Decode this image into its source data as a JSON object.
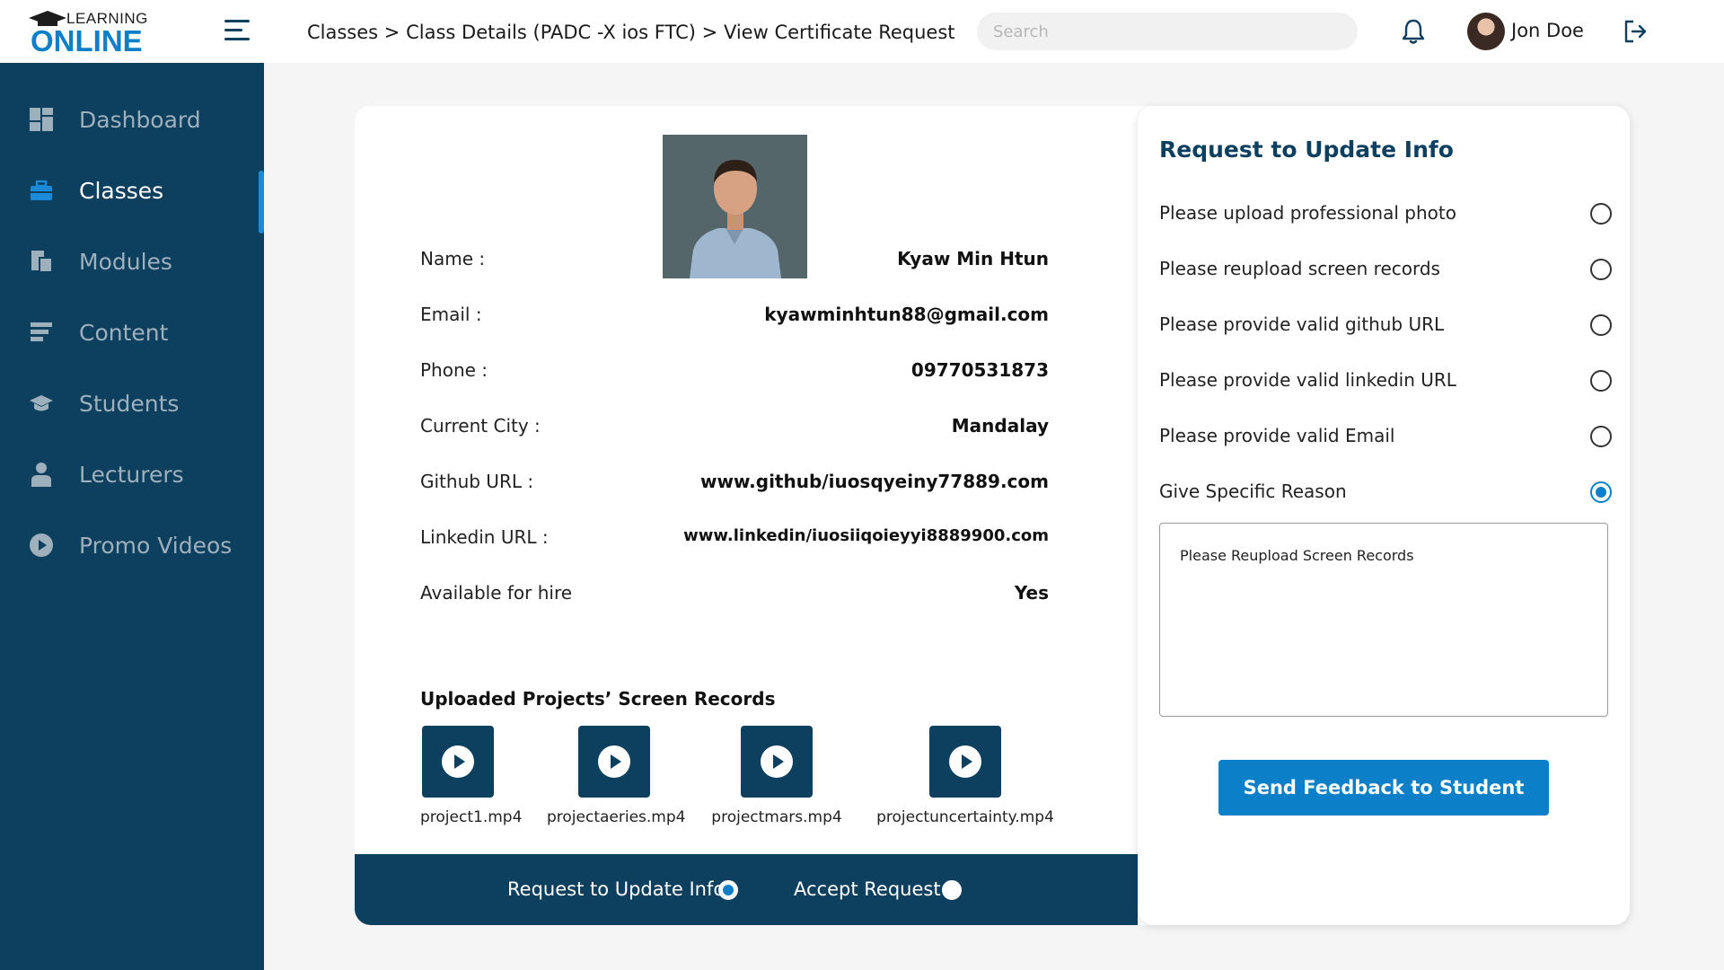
{
  "app": {
    "logo_small": "LEARNING",
    "logo_big": "ONLINE"
  },
  "header": {
    "breadcrumb": [
      {
        "label": "Classes"
      },
      {
        "label": "Class Details (PADC -X ios FTC)"
      },
      {
        "label": "View Certificate Request"
      }
    ],
    "breadcrumb_sep": ">",
    "search_placeholder": "Search",
    "user_name": "Jon Doe",
    "icons": {
      "menu": "hamburger-menu-icon",
      "bell": "bell-icon",
      "logout": "logout-icon"
    }
  },
  "sidebar": {
    "items": [
      {
        "label": "Dashboard",
        "icon": "dashboard-icon",
        "active": false
      },
      {
        "label": "Classes",
        "icon": "briefcase-icon",
        "active": true
      },
      {
        "label": "Modules",
        "icon": "modules-icon",
        "active": false
      },
      {
        "label": "Content",
        "icon": "content-icon",
        "active": false
      },
      {
        "label": "Students",
        "icon": "graduation-cap-icon",
        "active": false
      },
      {
        "label": "Lecturers",
        "icon": "lecturer-icon",
        "active": false
      },
      {
        "label": "Promo Videos",
        "icon": "play-circle-icon",
        "active": false
      }
    ]
  },
  "profile": {
    "fields": [
      {
        "key": "Name :",
        "value": "Kyaw Min Htun"
      },
      {
        "key": "Email :",
        "value": "kyawminhtun88@gmail.com"
      },
      {
        "key": "Phone :",
        "value": "09770531873"
      },
      {
        "key": "Current City :",
        "value": "Mandalay"
      },
      {
        "key": "Github URL :",
        "value": "www.github/iuosqyeiny77889.com"
      },
      {
        "key": "Linkedin URL :",
        "value": "www.linkedin/iuosiiqoieyyi8889900.com"
      },
      {
        "key": "Available for hire",
        "value": "Yes"
      }
    ],
    "records_title": "Uploaded Projects’ Screen Records",
    "records": [
      {
        "name": "project1.mp4"
      },
      {
        "name": "projectaeries.mp4"
      },
      {
        "name": "projectmars.mp4"
      },
      {
        "name": "projectuncertainty.mp4"
      }
    ]
  },
  "footer": {
    "options": [
      {
        "label": "Request to Update Info",
        "checked": true
      },
      {
        "label": "Accept Request",
        "checked": false
      }
    ]
  },
  "panel": {
    "title": "Request to Update Info",
    "options": [
      {
        "label": "Please upload professional photo",
        "checked": false
      },
      {
        "label": "Please reupload screen records",
        "checked": false
      },
      {
        "label": "Please provide valid github URL",
        "checked": false
      },
      {
        "label": "Please provide valid linkedin URL",
        "checked": false
      },
      {
        "label": "Please provide valid Email",
        "checked": false
      },
      {
        "label": "Give Specific Reason",
        "checked": true
      }
    ],
    "reason_text": "Please Reupload Screen Records",
    "send_button": "Send Feedback to Student"
  },
  "colors": {
    "navy": "#0d3f5e",
    "accent": "#0b7fc7",
    "background": "#f5f5f5"
  }
}
